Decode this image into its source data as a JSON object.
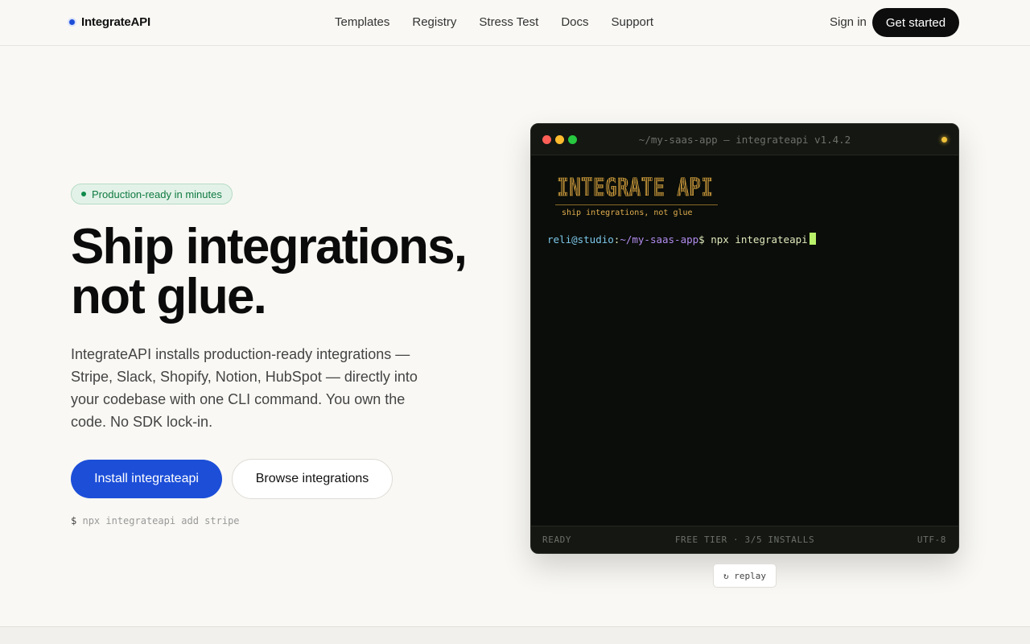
{
  "nav": {
    "brand": "IntegrateAPI",
    "links": [
      "Templates",
      "Registry",
      "Stress Test",
      "Docs",
      "Support"
    ],
    "sign_in": "Sign in",
    "cta": "Get started"
  },
  "hero": {
    "badge": "Production-ready in minutes",
    "title_line1": "Ship integrations,",
    "title_line2": "not glue.",
    "description": "IntegrateAPI installs production-ready integrations — Stripe, Slack, Shopify, Notion, HubSpot — directly into your codebase with one CLI command. You own the code. No SDK lock-in.",
    "primary_button": "Install integrateapi",
    "secondary_button": "Browse integrations",
    "command_prompt": "$",
    "command_hint": "npx integrateapi add stripe"
  },
  "terminal": {
    "title": "~/my-saas-app — integrateapi v1.4.2",
    "logo_text": "INTEGRATE API",
    "tagline": "ship integrations, not glue",
    "prompt_user": "reli@studio",
    "prompt_sep": ":",
    "prompt_path": "~/my-saas-app",
    "prompt_dollar": "$ ",
    "command": "npx integrateapi",
    "status_left": "READY",
    "status_mid": "FREE TIER · 3/5 INSTALLS",
    "status_right": "UTF-8",
    "replay": "↻ replay"
  },
  "colors": {
    "accent": "#1c4ed8",
    "badge_green": "#0f7a41",
    "terminal_bg": "#0a0d09",
    "logo_gold": "#d9a43f"
  }
}
